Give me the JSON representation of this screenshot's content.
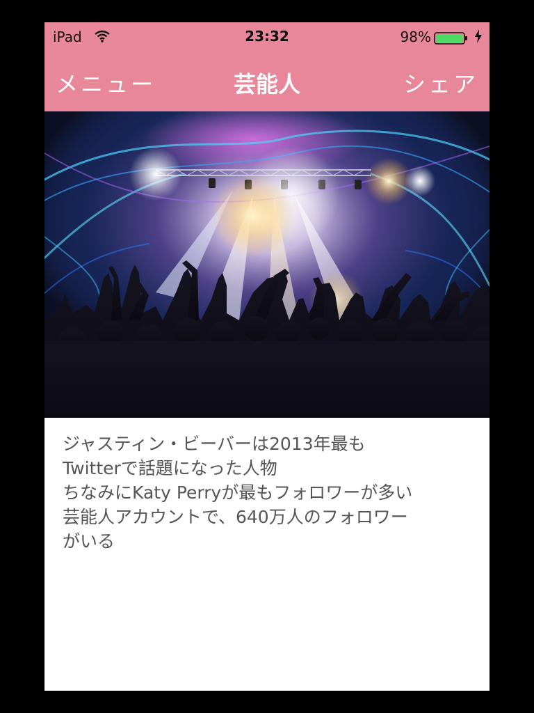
{
  "status_bar": {
    "device": "iPad",
    "time": "23:32",
    "battery": "98%"
  },
  "nav": {
    "left": "メニュー",
    "title": "芸能人",
    "right": "シェア"
  },
  "article": {
    "lines": [
      "ジャスティン・ビーバーは2013年最も",
      "Twitterで話題になった人物",
      "ちなみにKaty Perryが最もフォロワーが多い",
      "芸能人アカウントで、640万人のフォロワー",
      "がいる"
    ]
  },
  "colors": {
    "bar": "#e8879a",
    "text": "#555555",
    "battery_green": "#4cd964"
  },
  "icons": {
    "wifi": "wifi-icon",
    "battery": "battery-icon",
    "charging": "charging-icon"
  }
}
